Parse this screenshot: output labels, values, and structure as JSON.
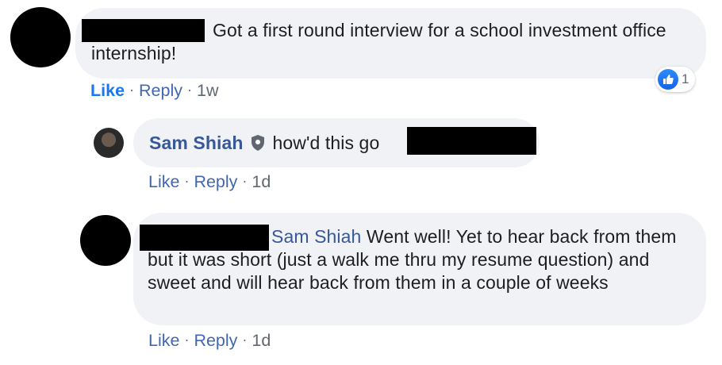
{
  "comments": [
    {
      "author_redacted": true,
      "text": "Got a first round interview for a school investment office internship!",
      "actions": {
        "like": "Like",
        "reply": "Reply",
        "time": "1w"
      },
      "reaction": {
        "icon": "like-icon",
        "count": "1"
      }
    },
    {
      "author": "Sam Shiah",
      "badge_icon": "shield-icon",
      "text": "how'd this go",
      "actions": {
        "like": "Like",
        "reply": "Reply",
        "time": "1d"
      }
    },
    {
      "author_redacted": true,
      "mention": "Sam Shiah",
      "text": "Went well! Yet to hear back from them but it was short (just a walk me thru my resume question) and sweet and will hear back from them in a couple of weeks",
      "actions": {
        "like": "Like",
        "reply": "Reply",
        "time": "1d"
      }
    }
  ],
  "separator": "·",
  "colors": {
    "bubble": "#f0f2f5",
    "link": "#385898",
    "like_blue": "#1877f2"
  }
}
